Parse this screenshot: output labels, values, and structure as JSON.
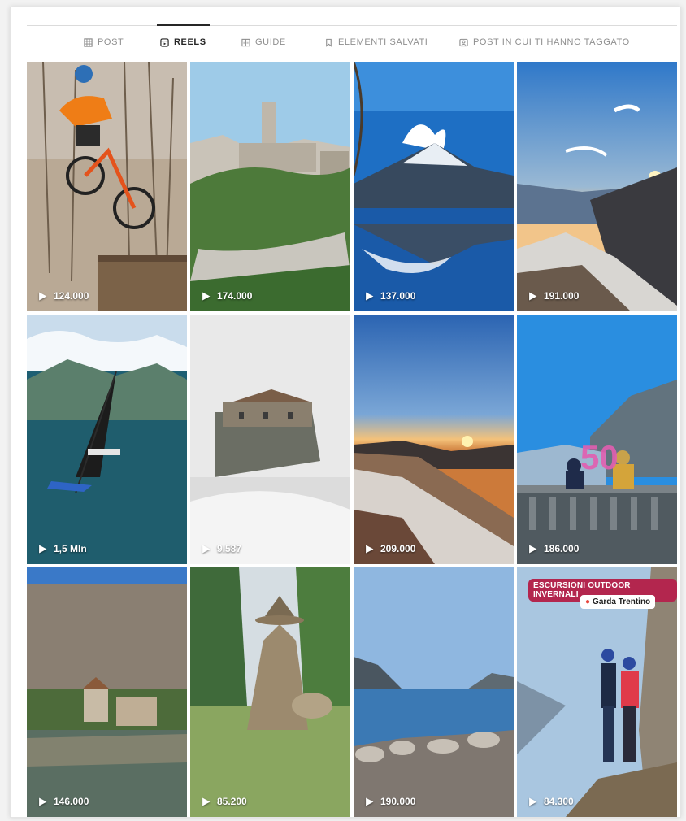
{
  "tabs": [
    {
      "label": "POST",
      "icon": "grid-icon",
      "active": false
    },
    {
      "label": "REELS",
      "icon": "reels-icon",
      "active": true
    },
    {
      "label": "GUIDE",
      "icon": "guide-icon",
      "active": false
    },
    {
      "label": "ELEMENTI SALVATI",
      "icon": "bookmark-icon",
      "active": false
    },
    {
      "label": "POST IN CUI TI HANNO TAGGATO",
      "icon": "tagged-icon",
      "active": false
    }
  ],
  "reels": [
    {
      "subject": "mountain-biker",
      "views": "124.000"
    },
    {
      "subject": "castle-on-cliff",
      "views": "174.000"
    },
    {
      "subject": "lake-reflection-mountain",
      "views": "137.000"
    },
    {
      "subject": "sunset-over-lake",
      "views": "191.000"
    },
    {
      "subject": "foiling-sailboat",
      "views": "1,5 Mln"
    },
    {
      "subject": "building-in-fog",
      "views": "9.587"
    },
    {
      "subject": "sunrise-hillside",
      "views": "209.000"
    },
    {
      "subject": "terrace-50-balloons",
      "views": "186.000"
    },
    {
      "subject": "lakeside-castle",
      "views": "146.000"
    },
    {
      "subject": "straw-witch-statue",
      "views": "85.200"
    },
    {
      "subject": "lake-shore",
      "views": "190.000"
    },
    {
      "subject": "hikers-couple",
      "views": "84.300",
      "banner": "ESCURSIONI OUTDOOR INVERNALI",
      "place": "Garda Trentino"
    }
  ],
  "colors": {
    "banner": "#b3264e",
    "active_tab": "#262626",
    "inactive_tab": "#8e8e8e"
  }
}
